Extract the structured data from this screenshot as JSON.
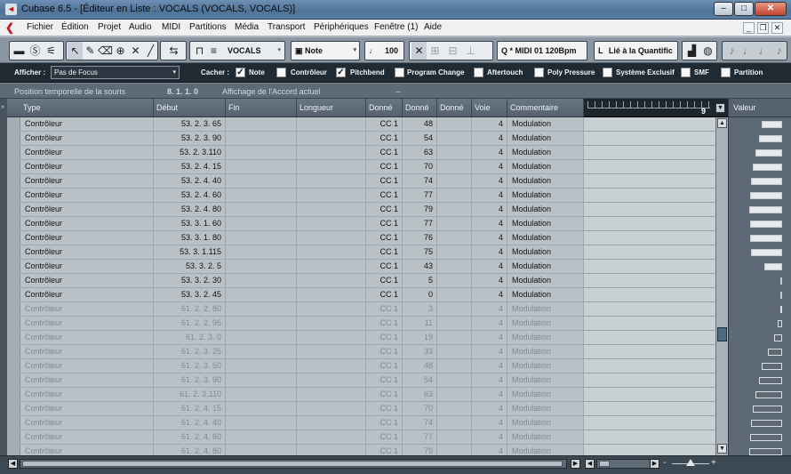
{
  "titlebar": {
    "title": "Cubase 6.5 - [Éditeur en Liste : VOCALS (VOCALS, VOCALS)]",
    "app_icon": "cubase-logo-icon",
    "minimize": "–",
    "maximize": "□",
    "close": "✕"
  },
  "menubar": {
    "items": [
      "Fichier",
      "Édition",
      "Projet",
      "Audio",
      "MIDI",
      "Partitions",
      "Média",
      "Transport",
      "Périphériques",
      "Fenêtre (1)",
      "Aide"
    ],
    "doc_minimize": "_",
    "doc_restore": "❐",
    "doc_close": "✕"
  },
  "toolbar": {
    "track_name": "VOCALS",
    "event_type": "Note",
    "velocity": "100",
    "midi_port": "* MIDI 01  120Bpm",
    "quantize": "Lié à la Quantific",
    "snap_label": "L"
  },
  "filterbar": {
    "show_label": "Afficher :",
    "focus_value": "Pas de Focus",
    "hide_label": "Cacher :",
    "filters": [
      {
        "label": "Note",
        "checked": true
      },
      {
        "label": "Contrôleur",
        "checked": false
      },
      {
        "label": "Pitchbend",
        "checked": true
      },
      {
        "label": "Program Change",
        "checked": false
      },
      {
        "label": "Aftertouch",
        "checked": false
      },
      {
        "label": "Poly Pressure",
        "checked": false
      },
      {
        "label": "Système Exclusif",
        "checked": false
      },
      {
        "label": "SMF",
        "checked": false
      },
      {
        "label": "Partition",
        "checked": false
      }
    ]
  },
  "infobar": {
    "mouse_pos_label": "Position temporelle de la souris",
    "mouse_pos_value": "8. 1. 1.    0",
    "chord_label": "Affichage de l'Accord actuel",
    "chord_value": "--"
  },
  "table": {
    "columns": [
      "Type",
      "Début",
      "Fin",
      "Longueur",
      "Donné",
      "Donné",
      "Donné",
      "Voie",
      "Commentaire"
    ],
    "rows": [
      {
        "type": "Contrôleur",
        "start": "53. 2. 3. 65",
        "d1": "CC 1",
        "d2": "48",
        "channel": "4",
        "comment": "Modulation",
        "dim": false
      },
      {
        "type": "Contrôleur",
        "start": "53. 2. 3. 90",
        "d1": "CC 1",
        "d2": "54",
        "channel": "4",
        "comment": "Modulation",
        "dim": false
      },
      {
        "type": "Contrôleur",
        "start": "53. 2. 3.110",
        "d1": "CC 1",
        "d2": "63",
        "channel": "4",
        "comment": "Modulation",
        "dim": false
      },
      {
        "type": "Contrôleur",
        "start": "53. 2. 4. 15",
        "d1": "CC 1",
        "d2": "70",
        "channel": "4",
        "comment": "Modulation",
        "dim": false
      },
      {
        "type": "Contrôleur",
        "start": "53. 2. 4. 40",
        "d1": "CC 1",
        "d2": "74",
        "channel": "4",
        "comment": "Modulation",
        "dim": false
      },
      {
        "type": "Contrôleur",
        "start": "53. 2. 4. 60",
        "d1": "CC 1",
        "d2": "77",
        "channel": "4",
        "comment": "Modulation",
        "dim": false
      },
      {
        "type": "Contrôleur",
        "start": "53. 2. 4. 80",
        "d1": "CC 1",
        "d2": "79",
        "channel": "4",
        "comment": "Modulation",
        "dim": false
      },
      {
        "type": "Contrôleur",
        "start": "53. 3. 1. 60",
        "d1": "CC 1",
        "d2": "77",
        "channel": "4",
        "comment": "Modulation",
        "dim": false
      },
      {
        "type": "Contrôleur",
        "start": "53. 3. 1. 80",
        "d1": "CC 1",
        "d2": "76",
        "channel": "4",
        "comment": "Modulation",
        "dim": false
      },
      {
        "type": "Contrôleur",
        "start": "53. 3. 1.115",
        "d1": "CC 1",
        "d2": "75",
        "channel": "4",
        "comment": "Modulation",
        "dim": false
      },
      {
        "type": "Contrôleur",
        "start": "53. 3. 2.    5",
        "d1": "CC 1",
        "d2": "43",
        "channel": "4",
        "comment": "Modulation",
        "dim": false
      },
      {
        "type": "Contrôleur",
        "start": "53. 3. 2. 30",
        "d1": "CC 1",
        "d2": "5",
        "channel": "4",
        "comment": "Modulation",
        "dim": false
      },
      {
        "type": "Contrôleur",
        "start": "53. 3. 2. 45",
        "d1": "CC 1",
        "d2": "0",
        "channel": "4",
        "comment": "Modulation",
        "dim": false
      },
      {
        "type": "Contrôleur",
        "start": "61. 2. 2. 80",
        "d1": "CC 1",
        "d2": "3",
        "channel": "4",
        "comment": "Modulation",
        "dim": true
      },
      {
        "type": "Contrôleur",
        "start": "61. 2. 2. 95",
        "d1": "CC 1",
        "d2": "11",
        "channel": "4",
        "comment": "Modulation",
        "dim": true
      },
      {
        "type": "Contrôleur",
        "start": "61. 2. 3.    0",
        "d1": "CC 1",
        "d2": "19",
        "channel": "4",
        "comment": "Modulation",
        "dim": true
      },
      {
        "type": "Contrôleur",
        "start": "61. 2. 3. 25",
        "d1": "CC 1",
        "d2": "33",
        "channel": "4",
        "comment": "Modulation",
        "dim": true
      },
      {
        "type": "Contrôleur",
        "start": "61. 2. 3. 50",
        "d1": "CC 1",
        "d2": "48",
        "channel": "4",
        "comment": "Modulation",
        "dim": true
      },
      {
        "type": "Contrôleur",
        "start": "61. 2. 3. 90",
        "d1": "CC 1",
        "d2": "54",
        "channel": "4",
        "comment": "Modulation",
        "dim": true
      },
      {
        "type": "Contrôleur",
        "start": "61. 2. 3.110",
        "d1": "CC 1",
        "d2": "63",
        "channel": "4",
        "comment": "Modulation",
        "dim": true
      },
      {
        "type": "Contrôleur",
        "start": "61. 2. 4. 15",
        "d1": "CC 1",
        "d2": "70",
        "channel": "4",
        "comment": "Modulation",
        "dim": true
      },
      {
        "type": "Contrôleur",
        "start": "61. 2. 4. 40",
        "d1": "CC 1",
        "d2": "74",
        "channel": "4",
        "comment": "Modulation",
        "dim": true
      },
      {
        "type": "Contrôleur",
        "start": "61. 2. 4. 60",
        "d1": "CC 1",
        "d2": "77",
        "channel": "4",
        "comment": "Modulation",
        "dim": true
      },
      {
        "type": "Contrôleur",
        "start": "61. 2. 4. 80",
        "d1": "CC 1",
        "d2": "79",
        "channel": "4",
        "comment": "Modulation",
        "dim": true
      }
    ]
  },
  "lane": {
    "bar_number": "9",
    "dropdown": "▼"
  },
  "values_panel": {
    "header": "Valeur"
  },
  "scrollbar": {
    "zoom_minus": "-",
    "zoom_plus": "+"
  }
}
